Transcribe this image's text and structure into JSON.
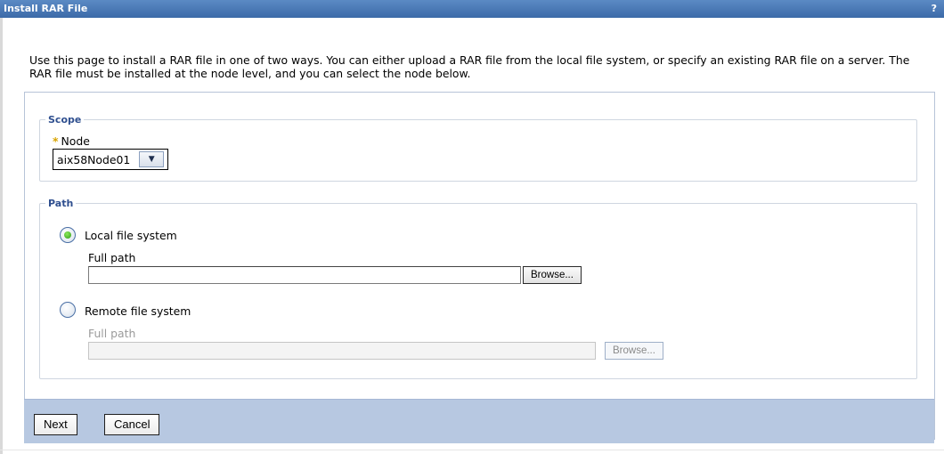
{
  "window": {
    "title": "Install RAR File",
    "help_label": "?"
  },
  "intro_text": "Use this page to install a RAR file in one of two ways. You can either upload a RAR file from the local file system, or specify an existing RAR file on a server. The RAR file must be installed at the node level, and you can select the node below.",
  "scope": {
    "legend": "Scope",
    "node_label": "Node",
    "required_marker": "*",
    "node_value": "aix58Node01"
  },
  "path": {
    "legend": "Path",
    "local": {
      "label": "Local file system",
      "selected": true,
      "full_path_label": "Full path",
      "full_path_value": "",
      "browse_label": "Browse..."
    },
    "remote": {
      "label": "Remote file system",
      "selected": false,
      "full_path_label": "Full path",
      "full_path_value": "",
      "browse_label": "Browse..."
    }
  },
  "footer": {
    "next_label": "Next",
    "cancel_label": "Cancel"
  },
  "colors": {
    "titlebar": "#3c6aa8",
    "footer": "#b7c8e1",
    "legend": "#2f4f8f",
    "radio_selected": "#2f9b18"
  }
}
